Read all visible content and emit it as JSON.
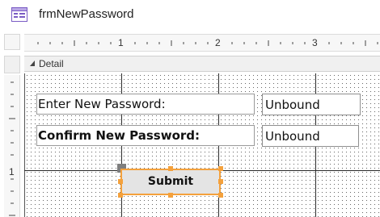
{
  "window": {
    "title": "frmNewPassword",
    "icon": "form-icon"
  },
  "ruler": {
    "horizontal_numbers": [
      "1",
      "2",
      "3"
    ],
    "vertical_numbers": [
      "1"
    ]
  },
  "section": {
    "label": "Detail",
    "collapse_icon": "collapse-arrow-icon"
  },
  "controls": {
    "new_password_label": "Enter New Password:",
    "confirm_password_label": "Confirm New Password:",
    "new_password_textbox": "Unbound",
    "confirm_password_textbox": "Unbound",
    "submit_button": "Submit"
  },
  "colors": {
    "selection": "#f4a13c",
    "button_face": "#e4e4e4",
    "grid_line": "#2a2a2a"
  }
}
